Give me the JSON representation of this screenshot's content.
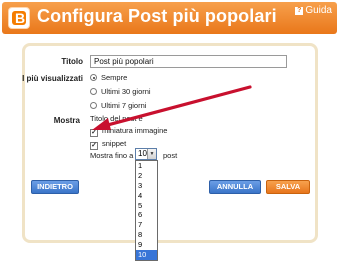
{
  "header": {
    "logo_letter": "B",
    "title": "Configura Post più popolari",
    "help_label": "Guida",
    "help_icon_glyph": "?"
  },
  "form": {
    "titolo_label": "Titolo",
    "titolo_value": "Post più popolari",
    "visualizzati_label": "I più visualizzati",
    "radio_options": [
      {
        "label": "Sempre",
        "selected": true
      },
      {
        "label": "Ultimi 30 giorni",
        "selected": false
      },
      {
        "label": "Ultimi 7 giorni",
        "selected": false
      }
    ],
    "mostra_label": "Mostra",
    "mostra_desc": "Titolo del post e",
    "checkboxes": [
      {
        "label": "miniatura immagine",
        "checked": true
      },
      {
        "label": "snippet",
        "checked": true
      }
    ],
    "mostra_fino_label": "Mostra fino a",
    "post_suffix": "post",
    "select_value": "10",
    "select_arrow": "▼",
    "dropdown_options": [
      "1",
      "2",
      "3",
      "4",
      "5",
      "6",
      "7",
      "8",
      "9",
      "10"
    ],
    "dropdown_selected": "10"
  },
  "buttons": {
    "back": "INDIETRO",
    "cancel": "ANNULLA",
    "save": "SALVA"
  },
  "colors": {
    "header_orange": "#e9771a",
    "button_blue": "#3a74c8",
    "button_orange": "#e7751c",
    "panel_border": "#f0e3c6",
    "annotation_arrow": "#c8102e",
    "dropdown_highlight": "#3875d7"
  }
}
